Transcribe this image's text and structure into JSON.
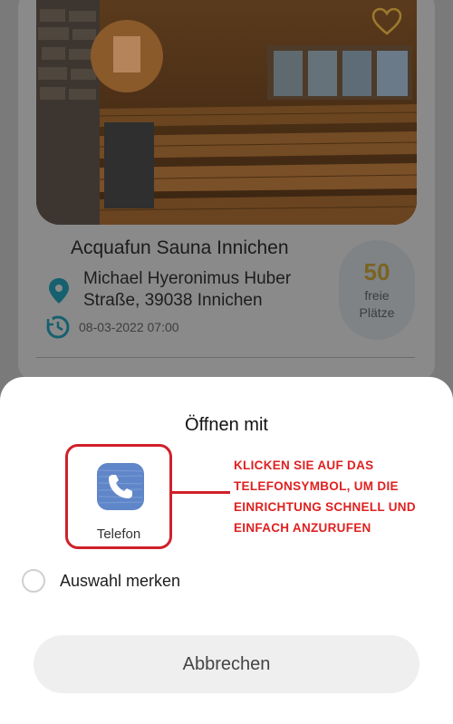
{
  "listing": {
    "title": "Acquafun Sauna Innichen",
    "address_line1": "Michael Hyeronimus Huber",
    "address_line2": "Straße, 39038 Innichen",
    "datetime": "08-03-2022 07:00",
    "free_spots_count": "50",
    "free_spots_label1": "freie",
    "free_spots_label2": "Plätze"
  },
  "open_with_sheet": {
    "title": "Öffnen mit",
    "apps": [
      {
        "label": "Telefon",
        "icon": "phone-icon"
      }
    ],
    "annotation": "KLICKEN SIE AUF DAS TELEFONSYMBOL, UM DIE EINRICHTUNG SCHNELL UND EINFACH ANZURUFEN",
    "remember_label": "Auswahl merken",
    "cancel_label": "Abbrechen"
  },
  "colors": {
    "annotation_red": "#e02020",
    "heart_gold": "#d9a93a",
    "spots_gold": "#c9a23a",
    "accent_teal": "#1e8fb0"
  }
}
